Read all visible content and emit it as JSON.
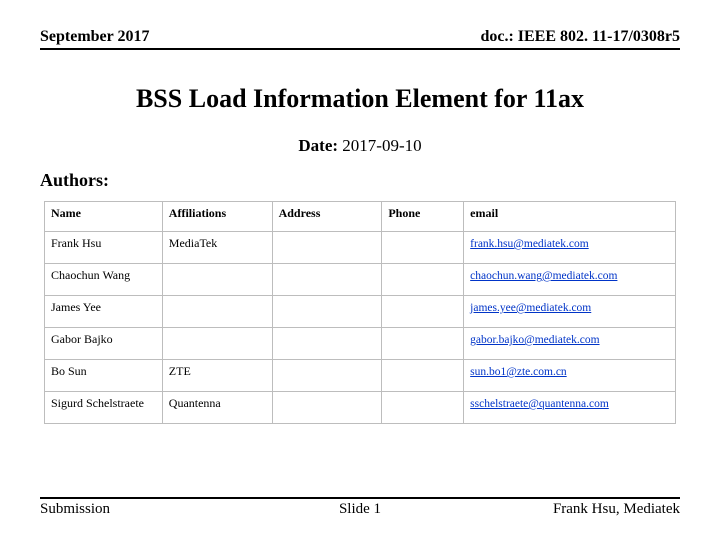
{
  "header": {
    "left": "September 2017",
    "right": "doc.: IEEE 802. 11-17/0308r5"
  },
  "title": "BSS Load Information Element for 11ax",
  "date": {
    "label": "Date:",
    "value": "2017-09-10"
  },
  "authors_label": "Authors:",
  "table": {
    "headers": [
      "Name",
      "Affiliations",
      "Address",
      "Phone",
      "email"
    ],
    "rows": [
      {
        "name": "Frank Hsu",
        "affil": "MediaTek",
        "addr": "",
        "phone": "",
        "email": "frank.hsu@mediatek.com"
      },
      {
        "name": "Chaochun Wang",
        "affil": "",
        "addr": "",
        "phone": "",
        "email": "chaochun.wang@mediatek.com"
      },
      {
        "name": "James Yee",
        "affil": "",
        "addr": "",
        "phone": "",
        "email": "james.yee@mediatek.com"
      },
      {
        "name": "Gabor Bajko",
        "affil": "",
        "addr": "",
        "phone": "",
        "email": "gabor.bajko@mediatek.com"
      },
      {
        "name": "Bo Sun",
        "affil": "ZTE",
        "addr": "",
        "phone": "",
        "email": "sun.bo1@zte.com.cn"
      },
      {
        "name": "Sigurd Schelstraete",
        "affil": "Quantenna",
        "addr": "",
        "phone": "",
        "email": "sschelstraete@quantenna.com"
      }
    ]
  },
  "footer": {
    "left": "Submission",
    "center": "Slide 1",
    "right": "Frank Hsu, Mediatek"
  }
}
